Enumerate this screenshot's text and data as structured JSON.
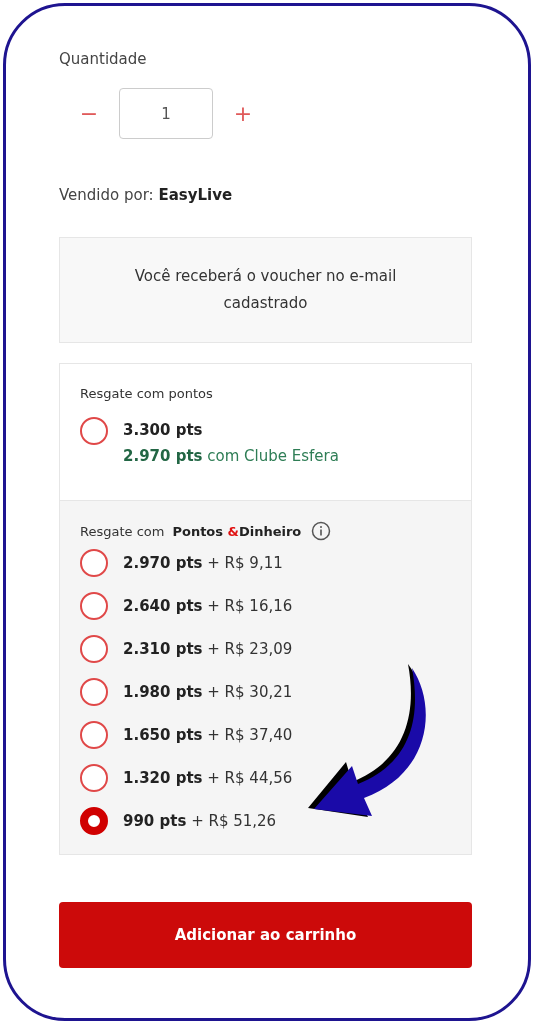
{
  "quantity": {
    "label": "Quantidade",
    "decrement": "−",
    "value": "1",
    "increment": "+"
  },
  "seller": {
    "label": "Vendido por:",
    "name": "EasyLive"
  },
  "notice": "Você receberá o voucher no e-mail cadastrado",
  "points_section": {
    "title": "Resgate com pontos",
    "options": [
      {
        "points": "3.300 pts",
        "club_points": "2.970 pts",
        "club_text": "com Clube Esfera",
        "selected": false
      }
    ]
  },
  "mixed_section": {
    "title_parts": [
      {
        "text": "Resgate com",
        "kind": "plain"
      },
      {
        "text": "Pontos ",
        "kind": "bold"
      },
      {
        "text": "&",
        "kind": "accent"
      },
      {
        "text": "Dinheiro",
        "kind": "bold"
      }
    ],
    "options": [
      {
        "points": "2.970 pts",
        "money": "+ R$ 9,11",
        "selected": false
      },
      {
        "points": "2.640 pts",
        "money": "+ R$ 16,16",
        "selected": false
      },
      {
        "points": "2.310 pts",
        "money": "+ R$ 23,09",
        "selected": false
      },
      {
        "points": "1.980 pts",
        "money": "+ R$ 30,21",
        "selected": false
      },
      {
        "points": "1.650 pts",
        "money": "+ R$ 37,40",
        "selected": false
      },
      {
        "points": "1.320 pts",
        "money": "+ R$ 44,56",
        "selected": false
      },
      {
        "points": "990 pts",
        "money": "+ R$ 51,26",
        "selected": true
      }
    ]
  },
  "button": "Adicionar ao carrinho"
}
